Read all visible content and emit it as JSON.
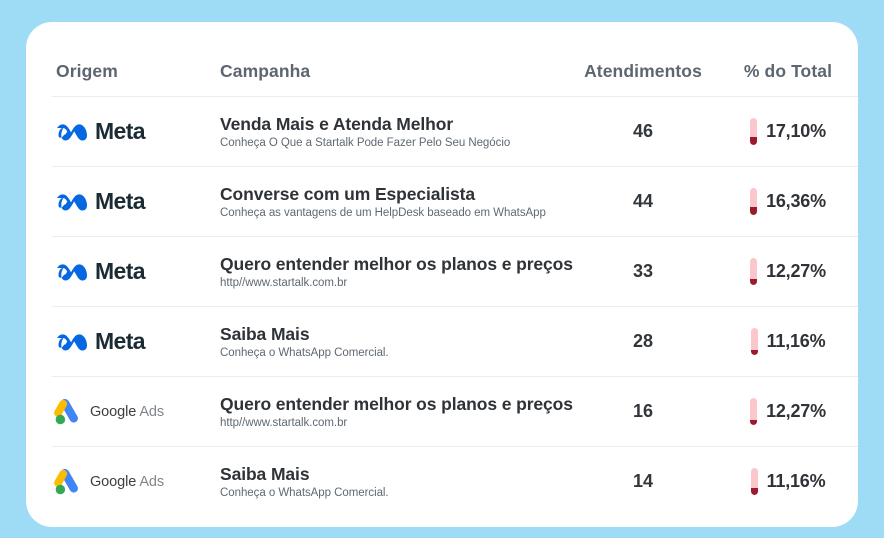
{
  "page": {
    "background_color": "#9edcf5",
    "card_background": "#ffffff"
  },
  "table": {
    "columns": [
      {
        "key": "origem",
        "label": "Origem"
      },
      {
        "key": "campanha",
        "label": "Campanha"
      },
      {
        "key": "atendimentos",
        "label": "Atendimentos"
      },
      {
        "key": "pct",
        "label": "% do Total"
      }
    ],
    "accent_colors": {
      "gauge_track": "#fbc7cd",
      "gauge_fill": "#9b1b2c",
      "meta_blue": "#0668E1",
      "google_blue": "#4285F4",
      "google_yellow": "#FBBC04",
      "google_green": "#34A853"
    },
    "rows": [
      {
        "source": "Meta",
        "source_icon": "meta-logo",
        "campaign_title": "Venda Mais e Atenda Melhor",
        "campaign_subtitle": "Conheça O Que a Startalk Pode Fazer Pelo Seu Negócio",
        "atendimentos": "46",
        "pct": "17,10%",
        "gauge_fill_pct": 30
      },
      {
        "source": "Meta",
        "source_icon": "meta-logo",
        "campaign_title": "Converse com um Especialista",
        "campaign_subtitle": "Conheça as vantagens de um HelpDesk baseado em WhatsApp",
        "atendimentos": "44",
        "pct": "16,36%",
        "gauge_fill_pct": 28
      },
      {
        "source": "Meta",
        "source_icon": "meta-logo",
        "campaign_title": "Quero entender melhor os planos e preços",
        "campaign_subtitle": "http//www.startalk.com.br",
        "atendimentos": "33",
        "pct": "12,27%",
        "gauge_fill_pct": 22
      },
      {
        "source": "Meta",
        "source_icon": "meta-logo",
        "campaign_title": "Saiba Mais",
        "campaign_subtitle": "Conheça o WhatsApp Comercial.",
        "atendimentos": "28",
        "pct": "11,16%",
        "gauge_fill_pct": 20
      },
      {
        "source": "Google Ads",
        "source_icon": "google-ads-logo",
        "campaign_title": "Quero entender melhor os planos e preços",
        "campaign_subtitle": "http//www.startalk.com.br",
        "atendimentos": "16",
        "pct": "12,27%",
        "gauge_fill_pct": 18
      },
      {
        "source": "Google Ads",
        "source_icon": "google-ads-logo",
        "campaign_title": "Saiba Mais",
        "campaign_subtitle": "Conheça o WhatsApp Comercial.",
        "atendimentos": "14",
        "pct": "11,16%",
        "gauge_fill_pct": 26
      }
    ]
  }
}
